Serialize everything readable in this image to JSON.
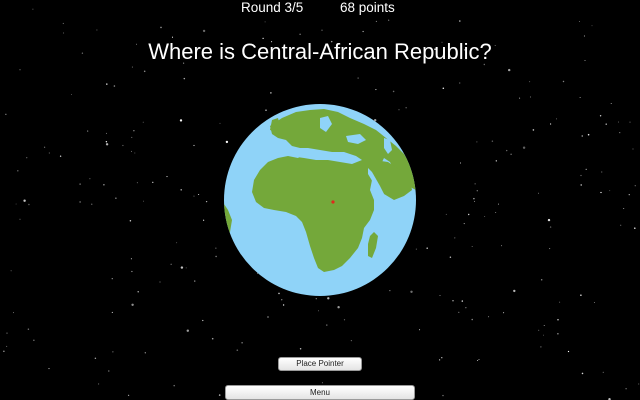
{
  "hud": {
    "round": "Round 3/5",
    "points": "68 points"
  },
  "question": "Where is Central-African Republic?",
  "globe": {
    "ocean_color": "#8fd3f8",
    "land_color": "#74a83a",
    "pointer_color": "#e0281c",
    "icon": "globe-earth-africa-view"
  },
  "buttons": {
    "place_pointer": "Place Pointer",
    "menu": "Menu"
  },
  "colors": {
    "background": "#000000",
    "text": "#ffffff"
  }
}
